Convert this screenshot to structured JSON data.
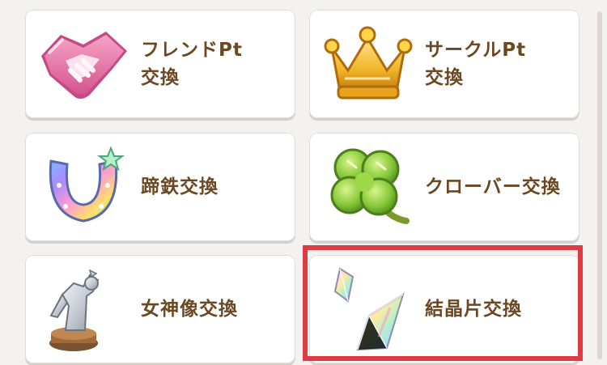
{
  "exchange_menu": {
    "items": [
      {
        "id": "friend-pt",
        "label": "フレンドPt\n交換",
        "icon": "handshake-icon"
      },
      {
        "id": "circle-pt",
        "label": "サークルPt\n交換",
        "icon": "crown-icon"
      },
      {
        "id": "horseshoe",
        "label": "蹄鉄交換",
        "icon": "horseshoe-icon"
      },
      {
        "id": "clover",
        "label": "クローバー交換",
        "icon": "clover-icon"
      },
      {
        "id": "goddess-statue",
        "label": "女神像交換",
        "icon": "goddess-statue-icon"
      },
      {
        "id": "crystal-shard",
        "label": "結晶片交換",
        "icon": "crystal-shard-icon"
      }
    ],
    "highlighted_item": "crystal-shard",
    "highlight_color": "#e03a44",
    "label_color": "#6b4722"
  }
}
